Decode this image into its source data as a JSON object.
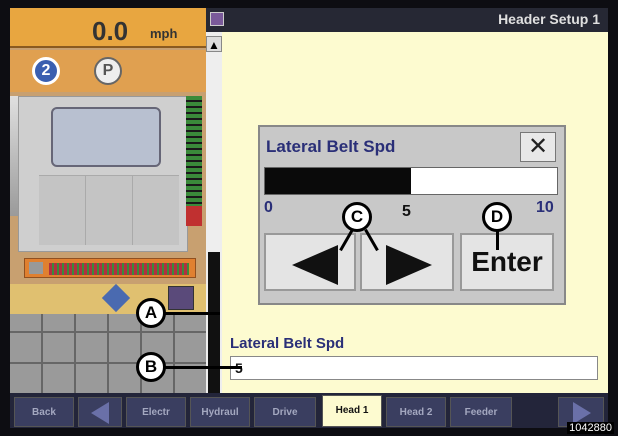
{
  "speed": {
    "value": "0.0",
    "unit": "mph"
  },
  "gear": {
    "number": "2",
    "park": "P"
  },
  "header": {
    "title": "Header Setup 1"
  },
  "dialog": {
    "title": "Lateral Belt Spd",
    "close_symbol": "✕",
    "min": "0",
    "max": "10",
    "value": "5",
    "progress": 0.5,
    "enter_label": "Enter"
  },
  "field": {
    "label": "Lateral Belt Spd",
    "value": "5"
  },
  "tabs": [
    {
      "label": "Back"
    },
    {
      "label": "Electr"
    },
    {
      "label": "Hydraul"
    },
    {
      "label": "Drive"
    },
    {
      "label": "Head 1"
    },
    {
      "label": "Head 2"
    },
    {
      "label": "Feeder"
    }
  ],
  "callouts": {
    "a": "A",
    "b": "B",
    "c": "C",
    "d": "D"
  },
  "figure_number": "1042880"
}
